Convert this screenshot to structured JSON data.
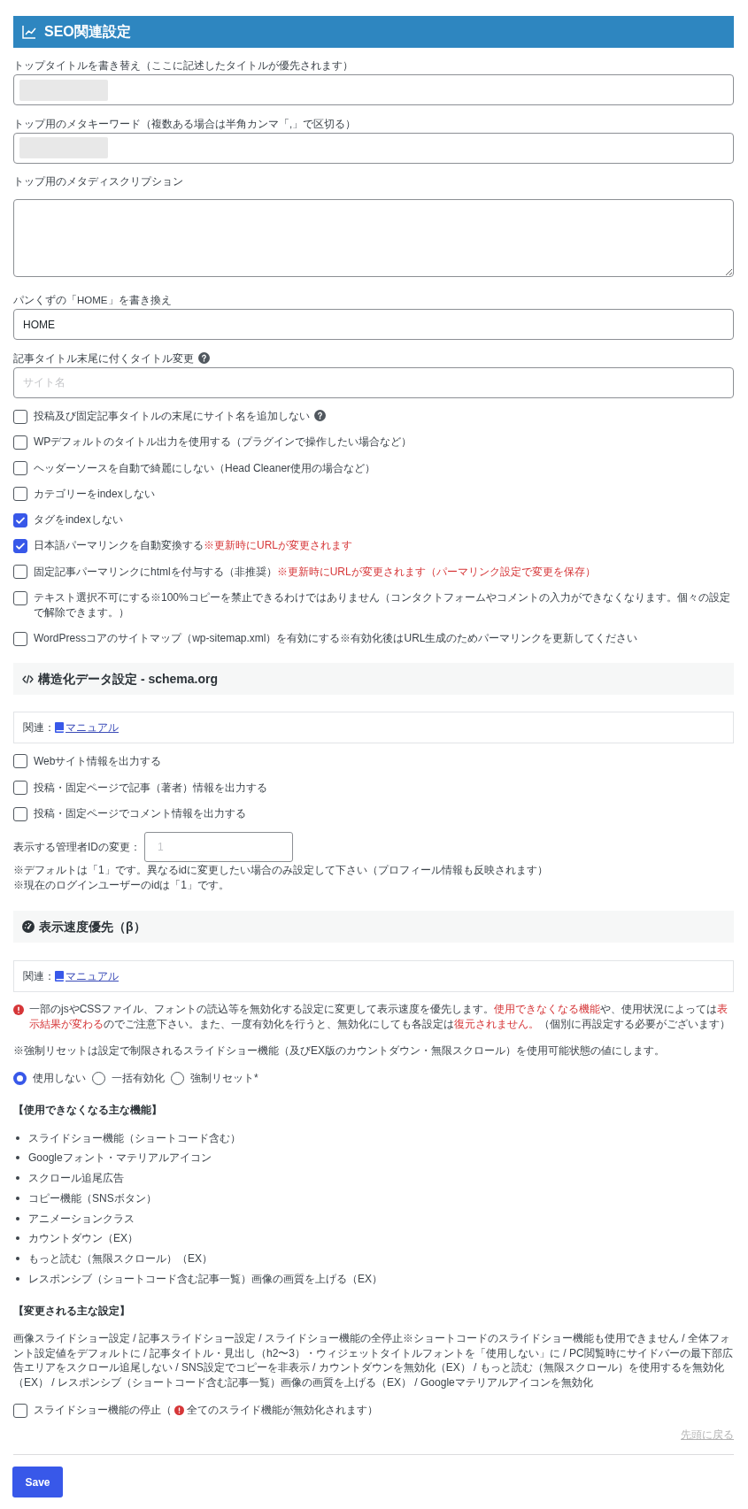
{
  "seo_section": {
    "title": "SEO関連設定",
    "fields": [
      {
        "kind": "text",
        "label": "トップタイトルを書き替え（ここに記述したタイトルが優先されます）",
        "blurred_value": true
      },
      {
        "kind": "text",
        "label": "トップ用のメタキーワード（複数ある場合は半角カンマ「,」で区切る）",
        "blurred_value": true
      },
      {
        "kind": "textarea",
        "label": "トップ用のメタディスクリプション"
      },
      {
        "kind": "text",
        "label": "パンくずの「HOME」を書き換え",
        "value": "HOME"
      },
      {
        "kind": "text",
        "label": "記事タイトル末尾に付くタイトル変更",
        "help": true,
        "placeholder": "サイト名"
      }
    ],
    "checkboxes": [
      {
        "label": "投稿及び固定記事タイトルの末尾にサイト名を追加しない",
        "help": true,
        "checked": false
      },
      {
        "label": "WPデフォルトのタイトル出力を使用する（プラグインで操作したい場合など）",
        "checked": false
      },
      {
        "label": "ヘッダーソースを自動で綺麗にしない（Head Cleaner使用の場合など）",
        "checked": false
      },
      {
        "label": "カテゴリーをindexしない",
        "checked": false
      },
      {
        "label": "タグをindexしない",
        "checked": true
      },
      {
        "label": "日本語パーマリンクを自動変換する",
        "note": "※更新時にURLが変更されます",
        "checked": true
      },
      {
        "label": "固定記事パーマリンクにhtmlを付与する（非推奨）",
        "note": "※更新時にURLが変更されます（パーマリンク設定で変更を保存）",
        "checked": false
      },
      {
        "label": "テキスト選択不可にする※100%コピーを禁止できるわけではありません（コンタクトフォームやコメントの入力ができなくなります。個々の設定で解除できます。）",
        "checked": false
      },
      {
        "label": "WordPressコアのサイトマップ（wp-sitemap.xml）を有効にする※有効化後はURL生成のためパーマリンクを更新してください",
        "checked": false
      }
    ]
  },
  "schema_section": {
    "title": "構造化データ設定 - schema.org",
    "related": {
      "label": "関連：",
      "link": "マニュアル"
    },
    "checkboxes": [
      {
        "label": "Webサイト情報を出力する",
        "checked": false
      },
      {
        "label": "投稿・固定ページで記事（著者）情報を出力する",
        "checked": false
      },
      {
        "label": "投稿・固定ページでコメント情報を出力する",
        "checked": false
      }
    ],
    "admin_id": {
      "label": "表示する管理者IDの変更：",
      "placeholder": "1"
    },
    "notes": [
      "※デフォルトは「1」です。異なるidに変更したい場合のみ設定して下さい（プロフィール情報も反映されます）",
      "※現在のログインユーザーのidは「1」です。"
    ]
  },
  "speed_section": {
    "title": "表示速度優先（β）",
    "related": {
      "label": "関連：",
      "link": "マニュアル"
    },
    "warning": [
      {
        "text": "一部のjsやCSSファイル、フォントの読込等を無効化する設定に変更して表示速度を優先します。",
        "alert": false
      },
      {
        "text": "使用できなくなる機能",
        "alert": true
      },
      {
        "text": "や、使用状況によっては",
        "alert": false
      },
      {
        "text": "表示結果が変わる",
        "alert": true
      },
      {
        "text": "のでご注意下さい。また、一度有効化を行うと、無効化にしても各設定は",
        "alert": false
      },
      {
        "text": "復元されません。",
        "alert": true
      },
      {
        "text": "（個別に再設定する必要がございます）",
        "alert": false
      }
    ],
    "note": "※強制リセットは設定で制限されるスライドショー機能（及びEX版のカウントダウン・無限スクロール）を使用可能状態の値にします。",
    "radios": [
      {
        "label": "使用しない",
        "selected": true
      },
      {
        "label": "一括有効化",
        "selected": false
      },
      {
        "label": "強制リセット*",
        "selected": false
      }
    ],
    "disabled_features": {
      "heading": "【使用できなくなる主な機能】",
      "items": [
        "スライドショー機能（ショートコード含む）",
        "Googleフォント・マテリアルアイコン",
        "スクロール追尾広告",
        "コピー機能（SNSボタン）",
        "アニメーションクラス",
        "カウントダウン（EX）",
        "もっと読む（無限スクロール）（EX）",
        "レスポンシブ（ショートコード含む記事一覧）画像の画質を上げる（EX）"
      ]
    },
    "changed_settings": {
      "heading": "【変更される主な設定】",
      "text": "画像スライドショー設定 / 記事スライドショー設定 / スライドショー機能の全停止※ショートコードのスライドショー機能も使用できません / 全体フォント設定値をデフォルトに / 記事タイトル・見出し（h2〜3）・ウィジェットタイトルフォントを「使用しない」に / PC閲覧時にサイドバーの最下部広告エリアをスクロール追尾しない / SNS設定でコピーを非表示 / カウントダウンを無効化（EX） / もっと読む（無限スクロール）を使用するを無効化（EX） / レスポンシブ（ショートコード含む記事一覧）画像の画質を上げる（EX） / Googleマテリアルアイコンを無効化"
    },
    "slideshow_stop": {
      "label": "スライドショー機能の停止（",
      "alert_text": "全てのスライド機能が無効化されます）",
      "checked": false
    }
  },
  "back_to_top": "先頭に戻る",
  "save_button": "Save"
}
